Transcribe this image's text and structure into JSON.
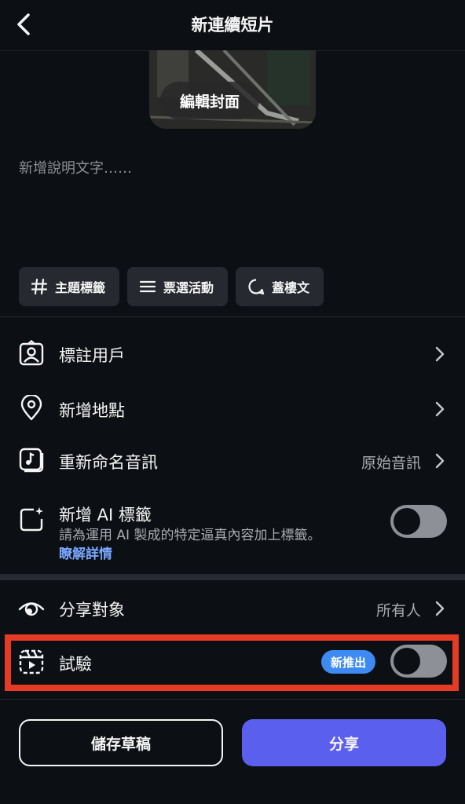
{
  "header": {
    "title": "新連續短片"
  },
  "cover": {
    "edit_label": "編輯封面"
  },
  "caption": {
    "placeholder": "新增說明文字……"
  },
  "chips": [
    {
      "icon": "hashtag-icon",
      "label": "主題標籤"
    },
    {
      "icon": "poll-icon",
      "label": "票選活動"
    },
    {
      "icon": "speech-bubble-icon",
      "label": "蓋樓文"
    }
  ],
  "rows": {
    "tag_people": {
      "label": "標註用戶",
      "icon": "tag-person-icon"
    },
    "add_location": {
      "label": "新增地點",
      "icon": "location-pin-icon"
    },
    "rename_audio": {
      "label": "重新命名音訊",
      "value": "原始音訊",
      "icon": "music-note-icon"
    },
    "ai_label": {
      "label": "新增 AI 標籤",
      "description": "請為運用 AI 製成的特定逼真內容加上標籤。",
      "link": "瞭解詳情",
      "icon": "ai-sparkle-icon",
      "toggle_on": false
    },
    "audience": {
      "label": "分享對象",
      "value": "所有人",
      "icon": "audience-eye-icon"
    },
    "trial": {
      "label": "試驗",
      "badge": "新推出",
      "icon": "trial-reel-icon",
      "toggle_on": false
    }
  },
  "actions": {
    "save_draft": "儲存草稿",
    "share": "分享"
  },
  "colors": {
    "background": "#0c1014",
    "accent": "#5b5fed",
    "badge": "#3d8af2",
    "highlight": "#e53a26",
    "link": "#7aa7ff"
  }
}
